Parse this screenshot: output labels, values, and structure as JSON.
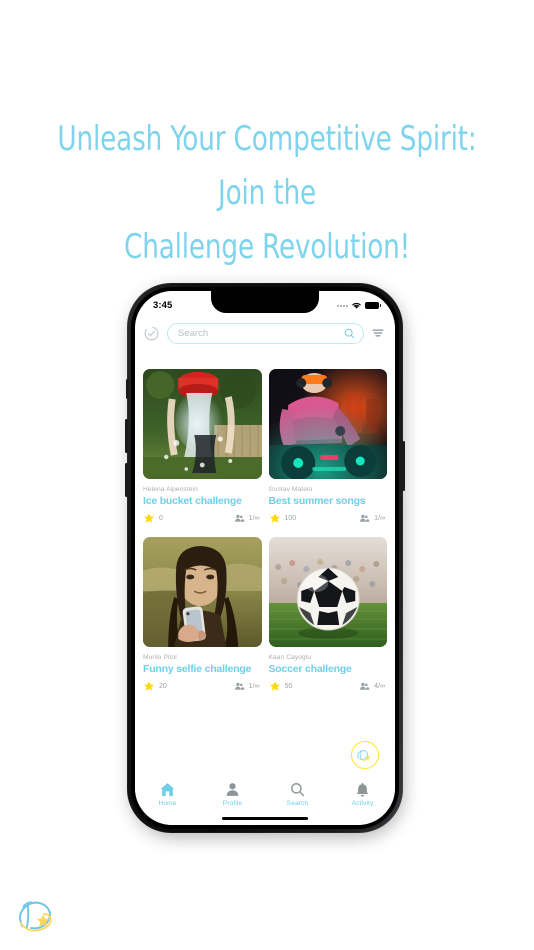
{
  "headline": {
    "line1": "Unleash Your Competitive Spirit: Join the",
    "line2": "Challenge Revolution!",
    "color": "#7ED4EC"
  },
  "phone": {
    "status_bar": {
      "time": "3:45",
      "wifi_icon": "wifi-icon",
      "battery_icon": "battery-icon",
      "signal_icon": "signal-dots-icon"
    },
    "header": {
      "logo_icon": "circle-check-logo-icon",
      "search_placeholder": "Search",
      "search_value": "",
      "search_icon": "search-icon",
      "filter_icon": "filter-icon"
    },
    "feed": {
      "cards": [
        {
          "author": "Helena Alpenstein",
          "title": "Ice bucket challenge",
          "stars": "0",
          "participants": "1/∞",
          "image": "ice-bucket-photo"
        },
        {
          "author": "Gustav Matelo",
          "title": "Best summer songs",
          "stars": "100",
          "participants": "1/∞",
          "image": "dj-photo"
        },
        {
          "author": "Murilo Pitol",
          "title": "Funny selfie challenge",
          "stars": "20",
          "participants": "1/∞",
          "image": "mona-lisa-selfie-photo"
        },
        {
          "author": "Kaan Cayoglu",
          "title": "Soccer challenge",
          "stars": "50",
          "participants": "4/∞",
          "image": "soccer-ball-photo"
        }
      ]
    },
    "fab": {
      "icon": "brand-d-logo-icon",
      "ring_color": "#FFE431"
    },
    "bottom_nav": {
      "items": [
        {
          "label": "Home",
          "icon": "home-icon",
          "active": true
        },
        {
          "label": "Profile",
          "icon": "person-icon",
          "active": false
        },
        {
          "label": "Search",
          "icon": "search-icon",
          "active": false
        },
        {
          "label": "Activity",
          "icon": "bell-icon",
          "active": false
        }
      ],
      "active_color": "#6fcfe9",
      "inactive_color": "#8e9599"
    }
  },
  "brandmark": {
    "icon": "brand-d-logo-icon"
  }
}
